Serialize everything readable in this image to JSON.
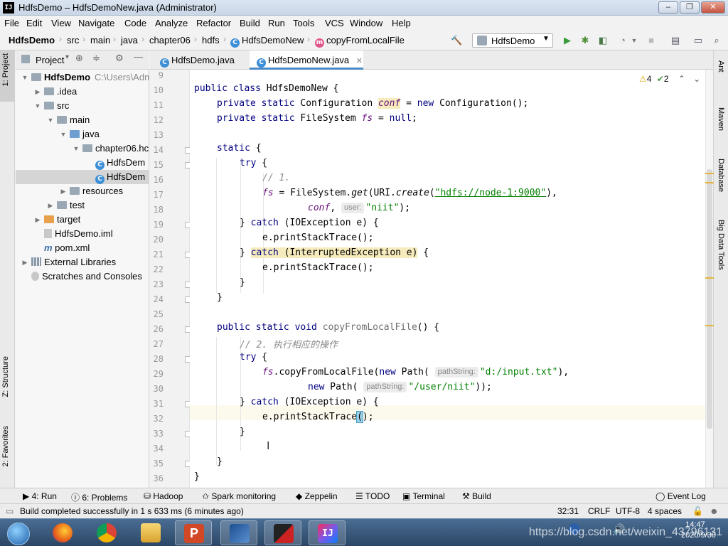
{
  "window": {
    "title": "HdfsDemo – HdfsDemoNew.java (Administrator)",
    "icon_text": "IJ"
  },
  "menu": [
    "File",
    "Edit",
    "View",
    "Navigate",
    "Code",
    "Analyze",
    "Refactor",
    "Build",
    "Run",
    "Tools",
    "VCS",
    "Window",
    "Help"
  ],
  "breadcrumb": [
    "HdfsDemo",
    "src",
    "main",
    "java",
    "chapter06",
    "hdfs",
    "HdfsDemoNew",
    "copyFromLocalFile"
  ],
  "run_config": "HdfsDemo",
  "project_panel": {
    "title": "Project",
    "tree": [
      {
        "label": "HdfsDemo",
        "extra": "C:\\Users\\Adm",
        "depth": 0,
        "expanded": true,
        "icon": "folder"
      },
      {
        "label": ".idea",
        "depth": 1,
        "expanded": false,
        "icon": "folder"
      },
      {
        "label": "src",
        "depth": 1,
        "expanded": true,
        "icon": "folder"
      },
      {
        "label": "main",
        "depth": 2,
        "expanded": true,
        "icon": "folder"
      },
      {
        "label": "java",
        "depth": 3,
        "expanded": true,
        "icon": "folder-blue"
      },
      {
        "label": "chapter06.hc",
        "depth": 4,
        "expanded": true,
        "icon": "package"
      },
      {
        "label": "HdfsDem",
        "depth": 5,
        "icon": "class"
      },
      {
        "label": "HdfsDem",
        "depth": 5,
        "icon": "class",
        "selected": true
      },
      {
        "label": "resources",
        "depth": 3,
        "expanded": false,
        "icon": "folder"
      },
      {
        "label": "test",
        "depth": 2,
        "expanded": false,
        "icon": "folder"
      },
      {
        "label": "target",
        "depth": 1,
        "expanded": false,
        "icon": "folder-orange"
      },
      {
        "label": "HdfsDemo.iml",
        "depth": 1,
        "icon": "file"
      },
      {
        "label": "pom.xml",
        "depth": 1,
        "icon": "maven"
      },
      {
        "label": "External Libraries",
        "depth": 0,
        "expanded": false,
        "icon": "library"
      },
      {
        "label": "Scratches and Consoles",
        "depth": 0,
        "icon": "scratch"
      }
    ]
  },
  "left_stripe": [
    "1: Project",
    "Z: Structure",
    "2: Favorites"
  ],
  "right_stripe": [
    "Ant",
    "Maven",
    "Database",
    "Big Data Tools"
  ],
  "editor_tabs": [
    {
      "label": "HdfsDemo.java",
      "active": false
    },
    {
      "label": "HdfsDemoNew.java",
      "active": true
    }
  ],
  "inspections": {
    "warnings": "4",
    "weak_warnings": "2"
  },
  "code": {
    "lines": [
      {
        "n": "9"
      },
      {
        "n": "10"
      },
      {
        "n": "11"
      },
      {
        "n": "12"
      },
      {
        "n": "13"
      },
      {
        "n": "14"
      },
      {
        "n": "15"
      },
      {
        "n": "16"
      },
      {
        "n": "17"
      },
      {
        "n": "18"
      },
      {
        "n": "19"
      },
      {
        "n": "20"
      },
      {
        "n": "21"
      },
      {
        "n": "22"
      },
      {
        "n": "23"
      },
      {
        "n": "24"
      },
      {
        "n": "25"
      },
      {
        "n": "26"
      },
      {
        "n": "27"
      },
      {
        "n": "28"
      },
      {
        "n": "29"
      },
      {
        "n": "30"
      },
      {
        "n": "31"
      },
      {
        "n": "32"
      },
      {
        "n": "33"
      },
      {
        "n": "34"
      },
      {
        "n": "35"
      },
      {
        "n": "36"
      }
    ],
    "t": {
      "l10a": "public class",
      "l10b": " HdfsDemoNew {",
      "l11a": "private static",
      "l11b": " Configuration ",
      "l11c": "conf",
      "l11d": " = ",
      "l11e": "new",
      "l11f": " Configuration();",
      "l12a": "private static",
      "l12b": " FileSystem ",
      "l12c": "fs",
      "l12d": " = ",
      "l12e": "null",
      "l12f": ";",
      "l14": "static",
      "l14b": " {",
      "l15": "try",
      "l15b": " {",
      "l16": "// 1.",
      "l17a": "fs",
      "l17b": " = FileSystem.",
      "l17c": "get",
      "l17d": "(URI.",
      "l17e": "create",
      "l17f": "(",
      "l17g": "\"hdfs://node-1:9000\"",
      "l17h": "),",
      "l18a": "conf",
      "l18b": ",",
      "l18hint": "user:",
      "l18c": "\"niit\"",
      "l18d": ");",
      "l19a": "} ",
      "l19b": "catch",
      "l19c": " (IOException e) {",
      "l20": "e.printStackTrace();",
      "l21a": "} ",
      "l21b": "catch",
      "l21c": " (InterruptedException e)",
      "l21d": " {",
      "l22": "e.printStackTrace();",
      "l23": "}",
      "l24": "}",
      "l26a": "public static void",
      "l26b": " copyFromLocalFile",
      "l26c": "() {",
      "l27": "// 2. 执行相应的操作",
      "l28": "try",
      "l28b": " {",
      "l29a": "fs",
      "l29b": ".copyFromLocalFile(",
      "l29c": "new",
      "l29d": " Path(",
      "l29hint": "pathString:",
      "l29e": "\"d:/input.txt\"",
      "l29f": "),",
      "l30a": "new",
      "l30b": " Path(",
      "l30hint": "pathString:",
      "l30c": "\"/user/niit\"",
      "l30d": "));",
      "l31a": "} ",
      "l31b": "catch",
      "l31c": " (IOException e) {",
      "l32a": "e.printStackTrace",
      "l32b": "(",
      "l32c": ");",
      "l33": "}",
      "l35": "}",
      "l36": "}"
    }
  },
  "bottom_tools": [
    "4: Run",
    "6: Problems",
    "Hadoop",
    "Spark monitoring",
    "Zeppelin",
    "TODO",
    "Terminal",
    "Build",
    "Event Log"
  ],
  "status": {
    "message": "Build completed successfully in 1 s 633 ms (6 minutes ago)",
    "position": "32:31",
    "line_sep": "CRLF",
    "encoding": "UTF-8",
    "indent": "4 spaces"
  },
  "taskbar": {
    "watermark": "https://blog.csdn.net/weixin_43796131",
    "time": "14:47",
    "date": "2020/9/30"
  },
  "colors": {
    "keyword": "#000080",
    "field": "#660e7a",
    "string": "#008000",
    "comment": "#8c8c8c",
    "accent": "#4a88c7"
  }
}
